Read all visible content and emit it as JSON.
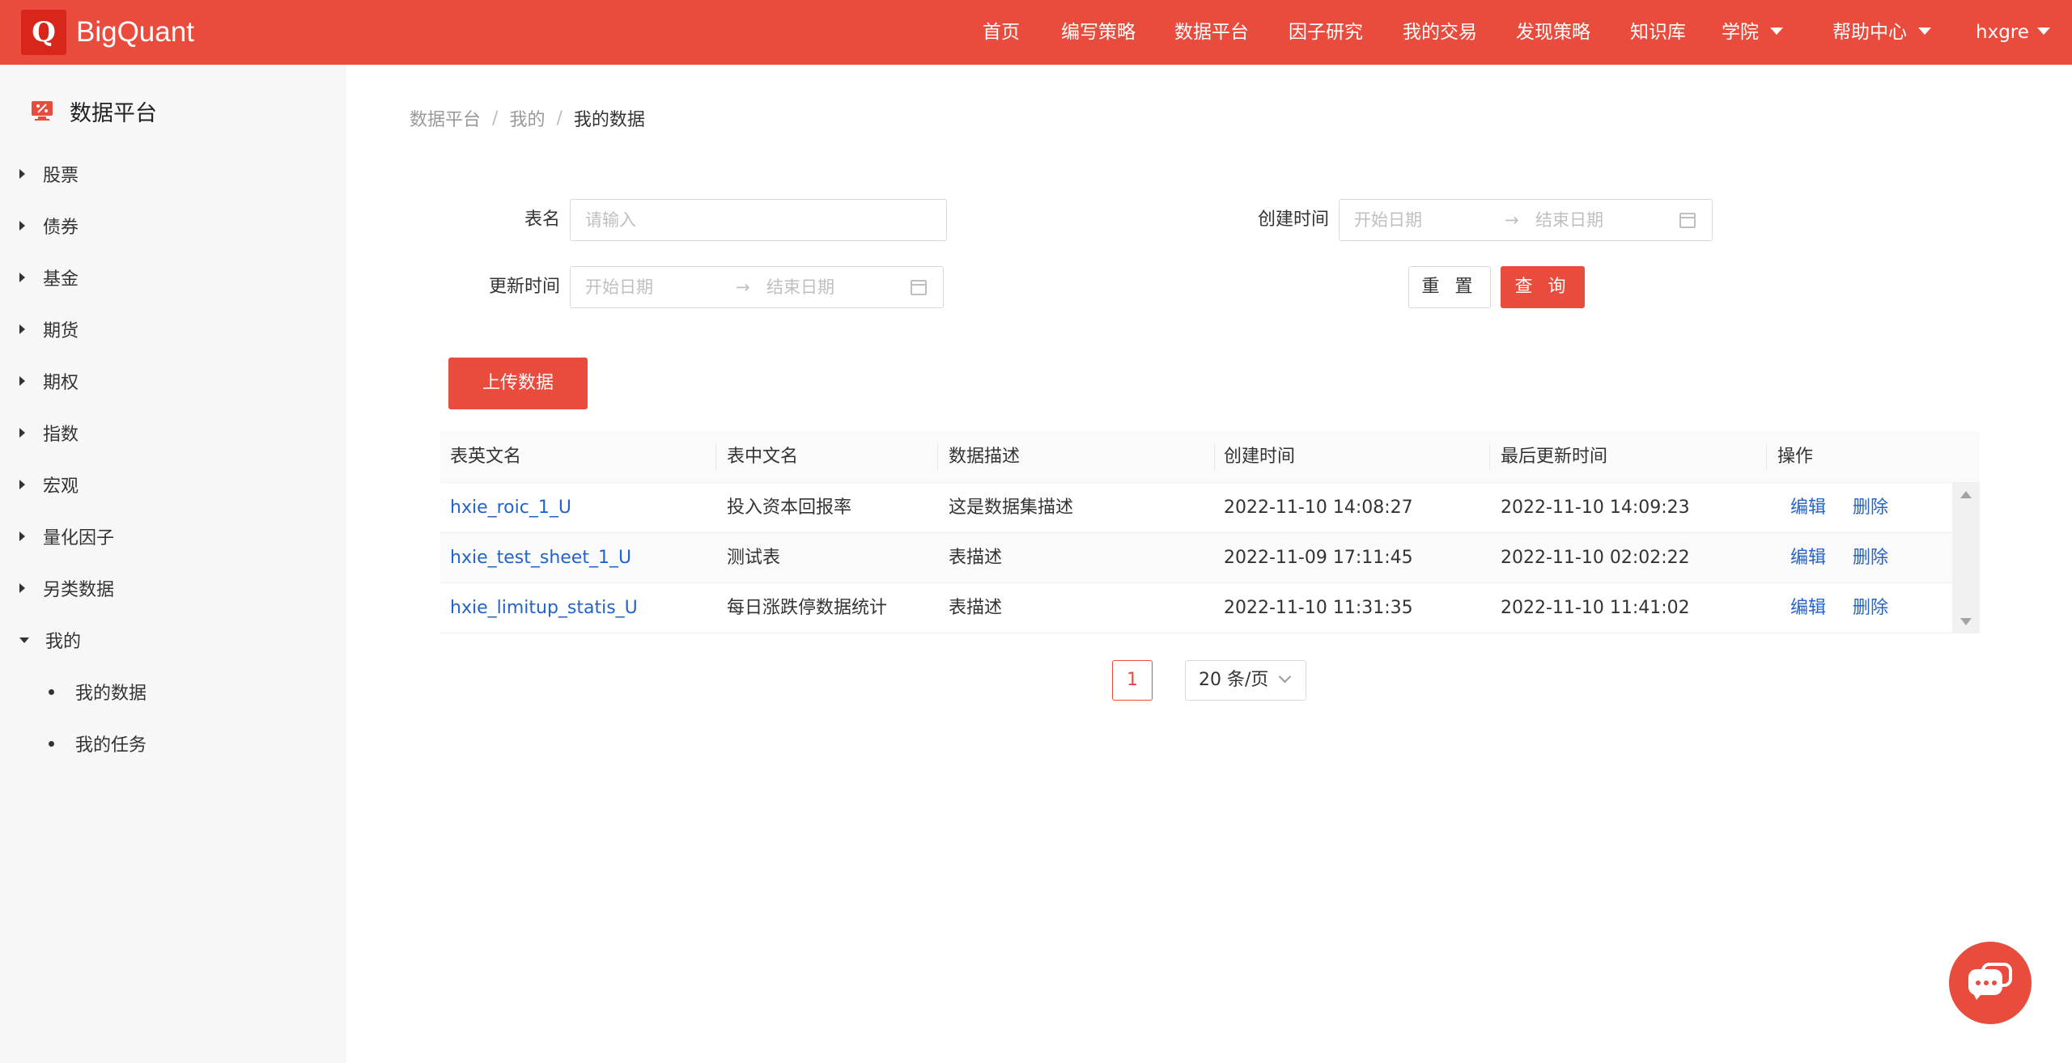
{
  "header": {
    "logo_letter": "Q",
    "brand": "BigQuant",
    "nav": [
      "首页",
      "编写策略",
      "数据平台",
      "因子研究",
      "我的交易",
      "发现策略",
      "知识库"
    ],
    "nav_dropdowns": [
      "学院",
      "帮助中心",
      "hxgre"
    ]
  },
  "sidebar": {
    "title": "数据平台",
    "items": [
      "股票",
      "债券",
      "基金",
      "期货",
      "期权",
      "指数",
      "宏观",
      "量化因子",
      "另类数据",
      "我的"
    ],
    "sub_items": [
      "我的数据",
      "我的任务"
    ]
  },
  "breadcrumb": [
    "数据平台",
    "我的",
    "我的数据"
  ],
  "filters": {
    "table_name_label": "表名",
    "table_name_placeholder": "请输入",
    "created_label": "创建时间",
    "updated_label": "更新时间",
    "start_placeholder": "开始日期",
    "end_placeholder": "结束日期",
    "reset_label": "重 置",
    "query_label": "查 询"
  },
  "upload_label": "上传数据",
  "table": {
    "columns": [
      "表英文名",
      "表中文名",
      "数据描述",
      "创建时间",
      "最后更新时间",
      "操作"
    ],
    "rows": [
      {
        "en": "hxie_roic_1_U",
        "cn": "投入资本回报率",
        "desc": "这是数据集描述",
        "created": "2022-11-10 14:08:27",
        "updated": "2022-11-10 14:09:23",
        "edit": "编辑",
        "delete": "删除"
      },
      {
        "en": "hxie_test_sheet_1_U",
        "cn": "测试表",
        "desc": "表描述",
        "created": "2022-11-09 17:11:45",
        "updated": "2022-11-10 02:02:22",
        "edit": "编辑",
        "delete": "删除"
      },
      {
        "en": "hxie_limitup_statis_U",
        "cn": "每日涨跌停数据统计",
        "desc": "表描述",
        "created": "2022-11-10 11:31:35",
        "updated": "2022-11-10 11:41:02",
        "edit": "编辑",
        "delete": "删除"
      }
    ]
  },
  "pagination": {
    "current_page": "1",
    "page_size": "20 条/页"
  },
  "colors": {
    "brand": "#e94b3c",
    "link": "#2463c9"
  }
}
